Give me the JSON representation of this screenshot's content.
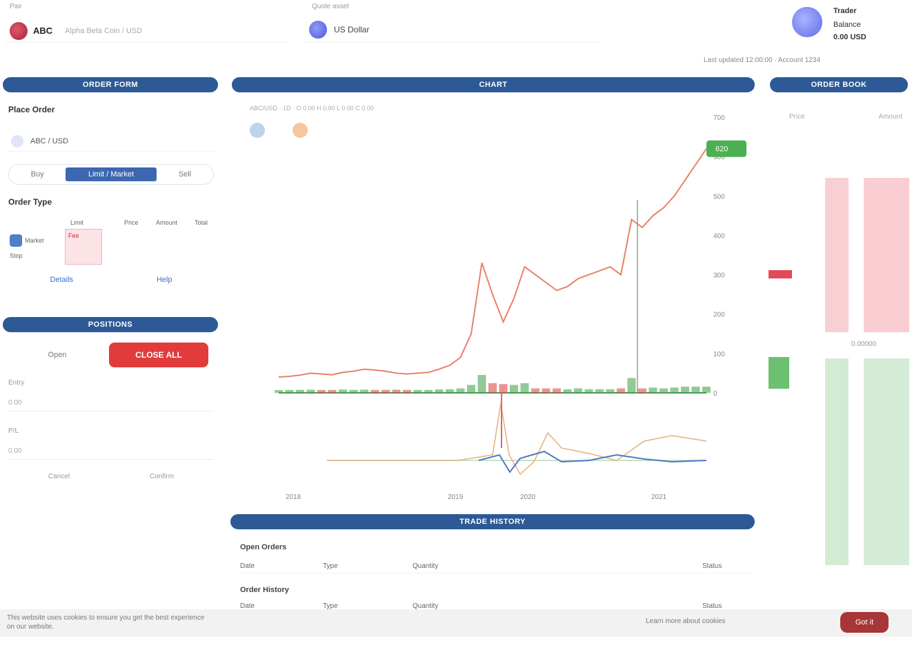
{
  "header": {
    "pair_label": "Pair",
    "pair_name": "ABC",
    "pair_desc": "Alpha Beta Coin / USD",
    "quote_label": "Quote asset",
    "quote_name": "US Dollar",
    "account": {
      "name": "Trader",
      "line2": "Balance",
      "line3": "0.00 USD",
      "info": "Last updated 12:00:00 · Account 1234"
    }
  },
  "panels": {
    "left_top": "ORDER FORM",
    "chart": "CHART",
    "orderbook": "ORDER BOOK",
    "left_bottom": "POSITIONS",
    "trades": "TRADE HISTORY"
  },
  "order_form": {
    "title": "Place Order",
    "asset": "ABC / USD",
    "toggle": [
      "Buy",
      "Limit / Market",
      "Sell"
    ],
    "sub_title": "Order Type",
    "grid_cols": [
      "Limit",
      "Price",
      "Amount",
      "Total"
    ],
    "grid_rows": [
      "Market",
      "Stop"
    ],
    "red_label": "Fee",
    "links": [
      "Details",
      "Help"
    ]
  },
  "positions": {
    "label": "Open",
    "button": "CLOSE ALL",
    "field1_label": "Entry",
    "field1_value": "0.00",
    "field2_label": "P/L",
    "field2_value": "0.00",
    "foot": [
      "Cancel",
      "Confirm"
    ]
  },
  "chart": {
    "meta": "ABC/USD · 1D · O 0.00 H 0.00 L 0.00 C 0.00",
    "price_ticks": [
      "700",
      "600",
      "500",
      "400",
      "300",
      "200",
      "100",
      "0"
    ],
    "last_price": "620",
    "x_labels": [
      "2018",
      "2019",
      "2020",
      "2021"
    ],
    "colors": {
      "up": "#3a9a43",
      "down": "#d83a3a",
      "line": "#e8806a",
      "bar": "#2d5a96"
    }
  },
  "chart_data": {
    "type": "line",
    "title": "",
    "xlabel": "",
    "ylabel": "",
    "x": [
      0,
      1,
      2,
      3,
      4,
      5,
      6,
      7,
      8,
      9,
      10,
      11,
      12,
      13,
      14,
      15,
      16,
      17,
      18,
      19,
      20,
      21,
      22,
      23,
      24,
      25,
      26,
      27,
      28,
      29,
      30,
      31,
      32,
      33,
      34,
      35,
      36,
      37,
      38,
      39,
      40
    ],
    "series": [
      {
        "values": [
          40,
          42,
          45,
          50,
          48,
          46,
          52,
          55,
          60,
          58,
          55,
          50,
          48,
          50,
          52,
          60,
          70,
          90,
          150,
          330,
          250,
          180,
          240,
          320,
          300,
          280,
          260,
          270,
          290,
          300,
          310,
          320,
          300,
          440,
          420,
          450,
          470,
          500,
          540,
          580,
          620
        ]
      }
    ],
    "ylim": [
      0,
      700
    ]
  },
  "orderbook": {
    "col_price": "Price",
    "col_amount": "Amount",
    "mid_price": "0.00000"
  },
  "trades": {
    "section1": "Open Orders",
    "cols1": [
      "Date",
      "Type",
      "Quantity",
      "Status"
    ],
    "section2": "Order History",
    "cols2": [
      "Date",
      "Type",
      "Quantity",
      "Status"
    ]
  },
  "cookie": {
    "text": "This website uses cookies to ensure you get the best experience on our website.",
    "link": "Learn more about cookies",
    "button": "Got it"
  }
}
